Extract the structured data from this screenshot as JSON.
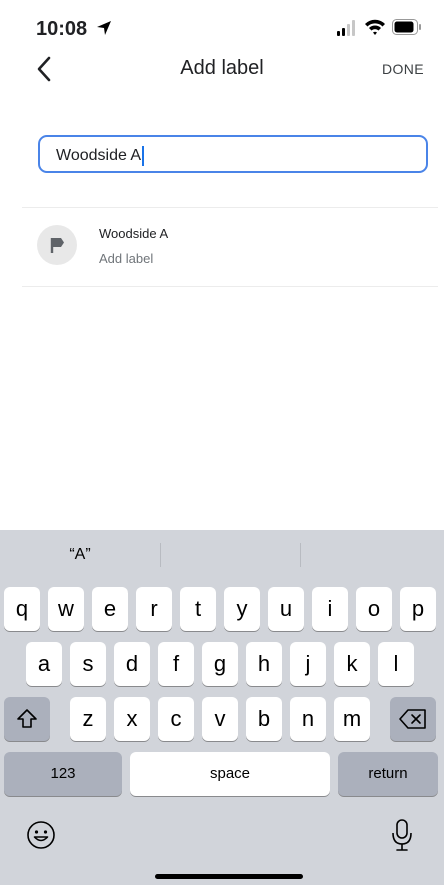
{
  "status": {
    "time": "10:08"
  },
  "header": {
    "title": "Add label",
    "done_label": "DONE"
  },
  "input": {
    "value": "Woodside A"
  },
  "suggestion": {
    "title": "Woodside A",
    "subtitle": "Add label"
  },
  "keyboard": {
    "predictions": [
      "“A”",
      "",
      ""
    ],
    "row1": [
      "q",
      "w",
      "e",
      "r",
      "t",
      "y",
      "u",
      "i",
      "o",
      "p"
    ],
    "row2": [
      "a",
      "s",
      "d",
      "f",
      "g",
      "h",
      "j",
      "k",
      "l"
    ],
    "row3": [
      "z",
      "x",
      "c",
      "v",
      "b",
      "n",
      "m"
    ],
    "numbers_label": "123",
    "space_label": "space",
    "return_label": "return"
  },
  "colors": {
    "accent": "#4a84e8",
    "keyboard_bg": "#d1d4da"
  }
}
